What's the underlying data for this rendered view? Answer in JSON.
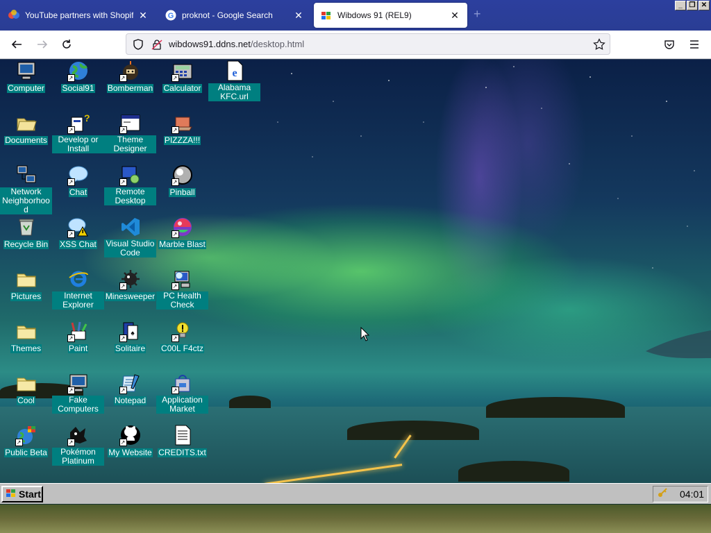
{
  "browser": {
    "tabs": [
      {
        "title": "YouTube partners with Shopify to a",
        "active": false,
        "favicon": "youtube-shopify-icon"
      },
      {
        "title": "proknot - Google Search",
        "active": false,
        "favicon": "google-icon"
      },
      {
        "title": "Wibdows 91 (REL9)",
        "active": true,
        "favicon": "wibdows-icon"
      }
    ],
    "new_tab": "+",
    "window_buttons": [
      "_",
      "❐",
      "✕"
    ],
    "address": {
      "host": "wibdows91.ddns.net",
      "path": "/desktop.html"
    },
    "colors": {
      "tabbar": "#2c3f9e",
      "active_tab": "#ffffff"
    }
  },
  "desktop": {
    "icons": [
      {
        "label": "Computer",
        "icon": "computer-icon",
        "shortcut": false
      },
      {
        "label": "Social91",
        "icon": "globe-icon",
        "shortcut": true
      },
      {
        "label": "Bomberman",
        "icon": "bomberman-icon",
        "shortcut": true
      },
      {
        "label": "Calculator",
        "icon": "calculator-icon",
        "shortcut": true
      },
      {
        "label": "Alabama KFC.url",
        "icon": "ie-document-icon",
        "shortcut": false
      },
      {
        "label": "Documents",
        "icon": "open-folder-icon",
        "shortcut": false
      },
      {
        "label": "Develop or Install",
        "icon": "develop-icon",
        "shortcut": true
      },
      {
        "label": "Theme Designer",
        "icon": "window-icon",
        "shortcut": true
      },
      {
        "label": "PIZZZA!!!",
        "icon": "pizza-laptop-icon",
        "shortcut": true
      },
      {
        "label": "Network Neighborhood",
        "icon": "network-icon",
        "shortcut": false
      },
      {
        "label": "Chat",
        "icon": "chat-bubble-icon",
        "shortcut": true
      },
      {
        "label": "Remote Desktop",
        "icon": "remote-desktop-icon",
        "shortcut": true
      },
      {
        "label": "Pinball",
        "icon": "pinball-icon",
        "shortcut": true
      },
      {
        "label": "Recycle Bin",
        "icon": "recycle-bin-icon",
        "shortcut": false
      },
      {
        "label": "XSS Chat",
        "icon": "warning-chat-icon",
        "shortcut": true
      },
      {
        "label": "Visual Studio Code",
        "icon": "vscode-icon",
        "shortcut": false
      },
      {
        "label": "Marble Blast",
        "icon": "marble-icon",
        "shortcut": true
      },
      {
        "label": "Pictures",
        "icon": "folder-icon",
        "shortcut": false
      },
      {
        "label": "Internet Explorer",
        "icon": "internet-explorer-icon",
        "shortcut": false
      },
      {
        "label": "Minesweeper",
        "icon": "mine-icon",
        "shortcut": true
      },
      {
        "label": "PC Health Check",
        "icon": "pc-health-icon",
        "shortcut": true
      },
      {
        "label": "Themes",
        "icon": "folder-icon",
        "shortcut": false
      },
      {
        "label": "Paint",
        "icon": "paint-icon",
        "shortcut": true
      },
      {
        "label": "Solitaire",
        "icon": "solitaire-icon",
        "shortcut": true
      },
      {
        "label": "C00L F4ctz",
        "icon": "lightbulb-icon",
        "shortcut": true
      },
      {
        "label": "Cool",
        "icon": "folder-icon",
        "shortcut": false
      },
      {
        "label": "Fake Computers",
        "icon": "computer-icon",
        "shortcut": true
      },
      {
        "label": "Notepad",
        "icon": "notepad-icon",
        "shortcut": true
      },
      {
        "label": "Application Market",
        "icon": "market-bag-icon",
        "shortcut": true
      },
      {
        "label": "Public Beta",
        "icon": "globe-flag-icon",
        "shortcut": true
      },
      {
        "label": "Pokémon Platinum",
        "icon": "pokemon-icon",
        "shortcut": true
      },
      {
        "label": "My Website",
        "icon": "github-icon",
        "shortcut": true
      },
      {
        "label": "CREDITS.txt",
        "icon": "text-file-icon",
        "shortcut": false
      }
    ],
    "label_color": "#007f80"
  },
  "taskbar": {
    "start_label": "Start",
    "clock": "04:01",
    "tray_icon": "key-icon"
  }
}
